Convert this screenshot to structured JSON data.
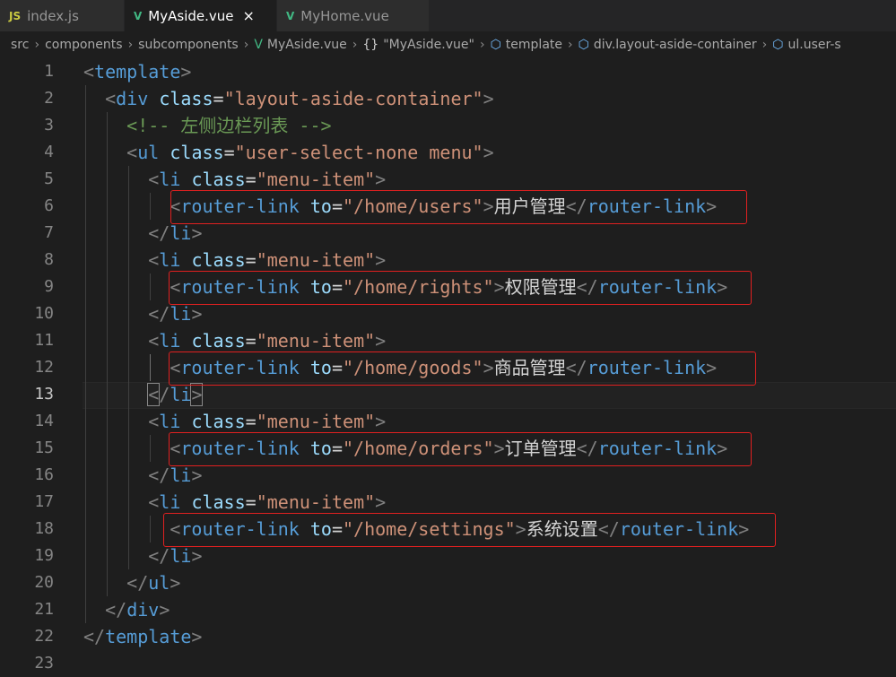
{
  "tabs": [
    {
      "icon": "js-file-icon",
      "icon_text": "JS",
      "label": "index.js",
      "active": false
    },
    {
      "icon": "vue-file-icon",
      "icon_text": "V",
      "label": "MyAside.vue",
      "active": true,
      "close": "×"
    },
    {
      "icon": "vue-file-icon",
      "icon_text": "V",
      "label": "MyHome.vue",
      "active": false
    }
  ],
  "breadcrumb": {
    "items": [
      "src",
      "components",
      "subcomponents",
      "MyAside.vue",
      "\"MyAside.vue\"",
      "template",
      "div.layout-aside-container",
      "ul.user-s"
    ],
    "icons": {
      "vue": "V",
      "object": "{}",
      "element": "⬡"
    }
  },
  "editor": {
    "current_line": 13,
    "lines": [
      {
        "n": "1",
        "tokens": [
          [
            "br",
            "<"
          ],
          [
            "tg",
            "template"
          ],
          [
            "br",
            ">"
          ]
        ]
      },
      {
        "n": "2",
        "tokens": [
          [
            "tx",
            "  "
          ],
          [
            "br",
            "<"
          ],
          [
            "tg",
            "div"
          ],
          [
            "tx",
            " "
          ],
          [
            "at",
            "class"
          ],
          [
            "eq",
            "="
          ],
          [
            "st",
            "\"layout-aside-container\""
          ],
          [
            "br",
            ">"
          ]
        ]
      },
      {
        "n": "3",
        "tokens": [
          [
            "tx",
            "    "
          ],
          [
            "cm",
            "<!-- 左侧边栏列表 -->"
          ]
        ]
      },
      {
        "n": "4",
        "tokens": [
          [
            "tx",
            "    "
          ],
          [
            "br",
            "<"
          ],
          [
            "tg",
            "ul"
          ],
          [
            "tx",
            " "
          ],
          [
            "at",
            "class"
          ],
          [
            "eq",
            "="
          ],
          [
            "st",
            "\"user-select-none menu\""
          ],
          [
            "br",
            ">"
          ]
        ]
      },
      {
        "n": "5",
        "tokens": [
          [
            "tx",
            "      "
          ],
          [
            "br",
            "<"
          ],
          [
            "tg",
            "li"
          ],
          [
            "tx",
            " "
          ],
          [
            "at",
            "class"
          ],
          [
            "eq",
            "="
          ],
          [
            "st",
            "\"menu-item\""
          ],
          [
            "br",
            ">"
          ]
        ]
      },
      {
        "n": "6",
        "tokens": [
          [
            "tx",
            "        "
          ],
          [
            "br",
            "<"
          ],
          [
            "tg",
            "router-link"
          ],
          [
            "tx",
            " "
          ],
          [
            "at",
            "to"
          ],
          [
            "eq",
            "="
          ],
          [
            "st",
            "\"/home/users\""
          ],
          [
            "br",
            ">"
          ],
          [
            "tx",
            "用户管理"
          ],
          [
            "br",
            "</"
          ],
          [
            "tg",
            "router-link"
          ],
          [
            "br",
            ">"
          ]
        ]
      },
      {
        "n": "7",
        "tokens": [
          [
            "tx",
            "      "
          ],
          [
            "br",
            "</"
          ],
          [
            "tg",
            "li"
          ],
          [
            "br",
            ">"
          ]
        ]
      },
      {
        "n": "8",
        "tokens": [
          [
            "tx",
            "      "
          ],
          [
            "br",
            "<"
          ],
          [
            "tg",
            "li"
          ],
          [
            "tx",
            " "
          ],
          [
            "at",
            "class"
          ],
          [
            "eq",
            "="
          ],
          [
            "st",
            "\"menu-item\""
          ],
          [
            "br",
            ">"
          ]
        ]
      },
      {
        "n": "9",
        "tokens": [
          [
            "tx",
            "        "
          ],
          [
            "br",
            "<"
          ],
          [
            "tg",
            "router-link"
          ],
          [
            "tx",
            " "
          ],
          [
            "at",
            "to"
          ],
          [
            "eq",
            "="
          ],
          [
            "st",
            "\"/home/rights\""
          ],
          [
            "br",
            ">"
          ],
          [
            "tx",
            "权限管理"
          ],
          [
            "br",
            "</"
          ],
          [
            "tg",
            "router-link"
          ],
          [
            "br",
            ">"
          ]
        ]
      },
      {
        "n": "10",
        "tokens": [
          [
            "tx",
            "      "
          ],
          [
            "br",
            "</"
          ],
          [
            "tg",
            "li"
          ],
          [
            "br",
            ">"
          ]
        ]
      },
      {
        "n": "11",
        "tokens": [
          [
            "tx",
            "      "
          ],
          [
            "br",
            "<"
          ],
          [
            "tg",
            "li"
          ],
          [
            "tx",
            " "
          ],
          [
            "at",
            "class"
          ],
          [
            "eq",
            "="
          ],
          [
            "st",
            "\"menu-item\""
          ],
          [
            "br",
            ">"
          ]
        ]
      },
      {
        "n": "12",
        "tokens": [
          [
            "tx",
            "        "
          ],
          [
            "br",
            "<"
          ],
          [
            "tg",
            "router-link"
          ],
          [
            "tx",
            " "
          ],
          [
            "at",
            "to"
          ],
          [
            "eq",
            "="
          ],
          [
            "st",
            "\"/home/goods\""
          ],
          [
            "br",
            ">"
          ],
          [
            "tx",
            "商品管理"
          ],
          [
            "br",
            "</"
          ],
          [
            "tg",
            "router-link"
          ],
          [
            "br",
            ">"
          ]
        ]
      },
      {
        "n": "13",
        "tokens": [
          [
            "tx",
            "      "
          ],
          [
            "br",
            "<"
          ],
          [
            "br",
            "/"
          ],
          [
            "tg",
            "li"
          ],
          [
            "br",
            ">"
          ]
        ]
      },
      {
        "n": "14",
        "tokens": [
          [
            "tx",
            "      "
          ],
          [
            "br",
            "<"
          ],
          [
            "tg",
            "li"
          ],
          [
            "tx",
            " "
          ],
          [
            "at",
            "class"
          ],
          [
            "eq",
            "="
          ],
          [
            "st",
            "\"menu-item\""
          ],
          [
            "br",
            ">"
          ]
        ]
      },
      {
        "n": "15",
        "tokens": [
          [
            "tx",
            "        "
          ],
          [
            "br",
            "<"
          ],
          [
            "tg",
            "router-link"
          ],
          [
            "tx",
            " "
          ],
          [
            "at",
            "to"
          ],
          [
            "eq",
            "="
          ],
          [
            "st",
            "\"/home/orders\""
          ],
          [
            "br",
            ">"
          ],
          [
            "tx",
            "订单管理"
          ],
          [
            "br",
            "</"
          ],
          [
            "tg",
            "router-link"
          ],
          [
            "br",
            ">"
          ]
        ]
      },
      {
        "n": "16",
        "tokens": [
          [
            "tx",
            "      "
          ],
          [
            "br",
            "</"
          ],
          [
            "tg",
            "li"
          ],
          [
            "br",
            ">"
          ]
        ]
      },
      {
        "n": "17",
        "tokens": [
          [
            "tx",
            "      "
          ],
          [
            "br",
            "<"
          ],
          [
            "tg",
            "li"
          ],
          [
            "tx",
            " "
          ],
          [
            "at",
            "class"
          ],
          [
            "eq",
            "="
          ],
          [
            "st",
            "\"menu-item\""
          ],
          [
            "br",
            ">"
          ]
        ]
      },
      {
        "n": "18",
        "tokens": [
          [
            "tx",
            "        "
          ],
          [
            "br",
            "<"
          ],
          [
            "tg",
            "router-link"
          ],
          [
            "tx",
            " "
          ],
          [
            "at",
            "to"
          ],
          [
            "eq",
            "="
          ],
          [
            "st",
            "\"/home/settings\""
          ],
          [
            "br",
            ">"
          ],
          [
            "tx",
            "系统设置"
          ],
          [
            "br",
            "</"
          ],
          [
            "tg",
            "router-link"
          ],
          [
            "br",
            ">"
          ]
        ]
      },
      {
        "n": "19",
        "tokens": [
          [
            "tx",
            "      "
          ],
          [
            "br",
            "</"
          ],
          [
            "tg",
            "li"
          ],
          [
            "br",
            ">"
          ]
        ]
      },
      {
        "n": "20",
        "tokens": [
          [
            "tx",
            "    "
          ],
          [
            "br",
            "</"
          ],
          [
            "tg",
            "ul"
          ],
          [
            "br",
            ">"
          ]
        ]
      },
      {
        "n": "21",
        "tokens": [
          [
            "tx",
            "  "
          ],
          [
            "br",
            "</"
          ],
          [
            "tg",
            "div"
          ],
          [
            "br",
            ">"
          ]
        ]
      },
      {
        "n": "22",
        "tokens": [
          [
            "br",
            "</"
          ],
          [
            "tg",
            "template"
          ],
          [
            "br",
            ">"
          ]
        ]
      },
      {
        "n": "23",
        "tokens": []
      }
    ],
    "highlighted_lines": [
      6,
      9,
      12,
      15,
      18
    ]
  },
  "colors": {
    "background": "#1e1e1e",
    "tag": "#569cd6",
    "attribute": "#9cdcfe",
    "string": "#ce9178",
    "comment": "#6a9955",
    "highlight_box": "#e02020"
  }
}
